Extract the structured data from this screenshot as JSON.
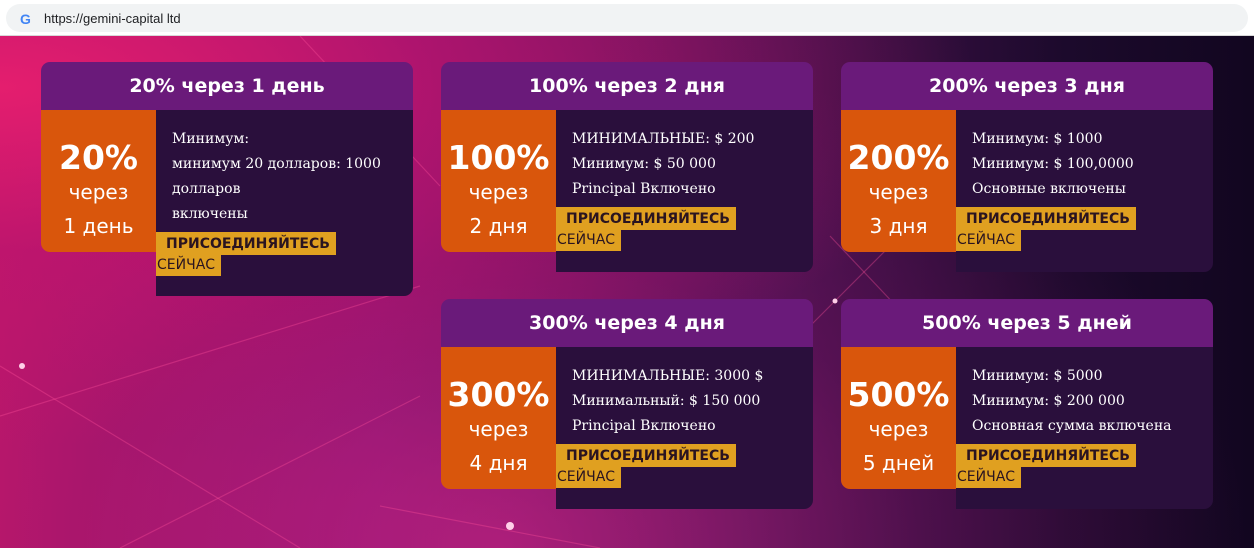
{
  "browser": {
    "url": "https://gemini-capital ltd"
  },
  "plans": [
    {
      "title": "20% через 1 день",
      "percent": "20%",
      "via": "через",
      "days": "1 день",
      "details": [
        "Минимум:",
        "минимум 20 долларов: 1000",
        "долларов",
        "включены"
      ],
      "join_line1": "ПРИСОЕДИНЯЙТЕСЬ",
      "join_line2": "СЕЙЧАС"
    },
    {
      "title": "100% через 2 дня",
      "percent": "100%",
      "via": "через",
      "days": "2 дня",
      "details": [
        "МИНИМАЛЬНЫЕ: $ 200",
        "Минимум: $ 50 000",
        "Principal Включено"
      ],
      "join_line1": "ПРИСОЕДИНЯЙТЕСЬ",
      "join_line2": "СЕЙЧАС"
    },
    {
      "title": "200% через 3 дня",
      "percent": "200%",
      "via": "через",
      "days": "3 дня",
      "details": [
        "Минимум: $ 1000",
        "Минимум: $ 100,0000",
        "Основные включены"
      ],
      "join_line1": "ПРИСОЕДИНЯЙТЕСЬ",
      "join_line2": "СЕЙЧАС"
    },
    {
      "title": "300% через 4 дня",
      "percent": "300%",
      "via": "через",
      "days": "4 дня",
      "details": [
        "МИНИМАЛЬНЫЕ: 3000 $",
        "Минимальный: $ 150 000",
        "Principal Включено"
      ],
      "join_line1": "ПРИСОЕДИНЯЙТЕСЬ",
      "join_line2": "СЕЙЧАС"
    },
    {
      "title": "500% через 5 дней",
      "percent": "500%",
      "via": "через",
      "days": "5 дней",
      "details": [
        "Минимум: $ 5000",
        "Минимум: $ 200 000",
        "Основная сумма включена"
      ],
      "join_line1": "ПРИСОЕДИНЯЙТЕСЬ",
      "join_line2": "СЕЙЧАС"
    }
  ],
  "colors": {
    "header": "#6a1a7a",
    "badge": "#d9560c",
    "details": "#2a0f3c",
    "join": "#e0a020"
  }
}
